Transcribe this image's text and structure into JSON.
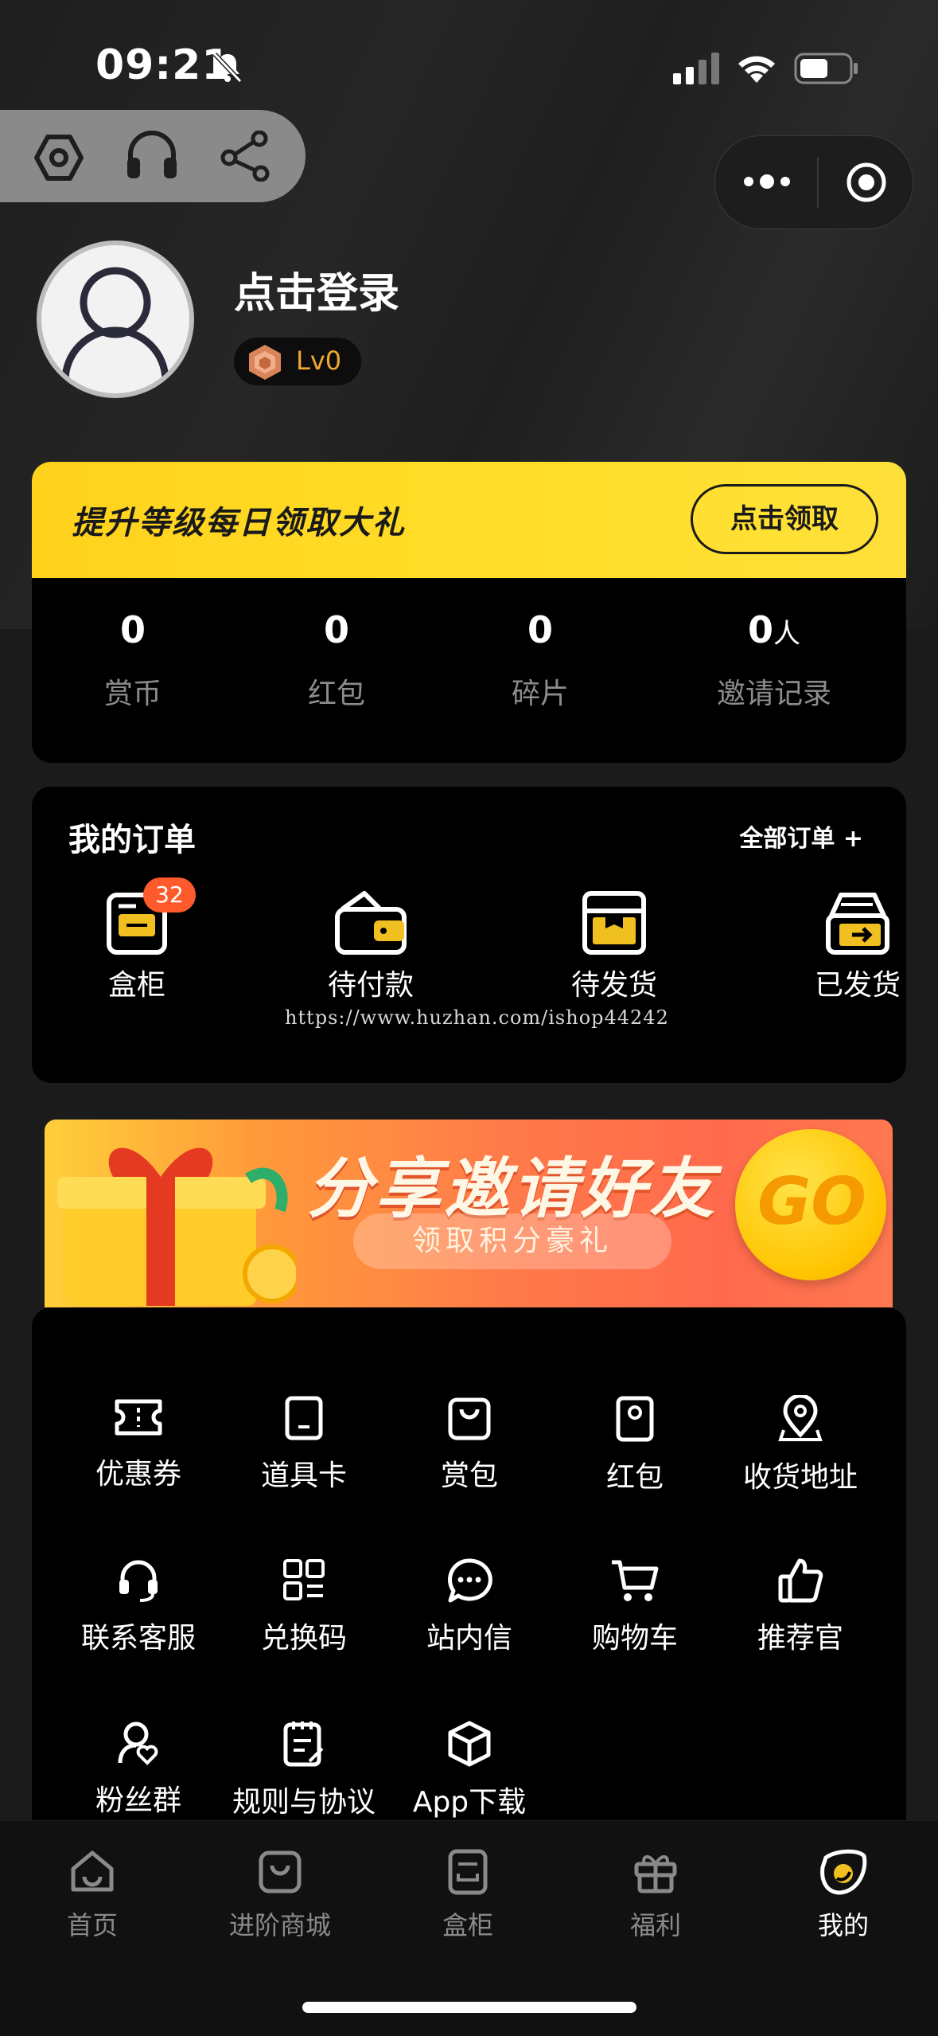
{
  "status_bar": {
    "time": "09:21"
  },
  "profile": {
    "login_text": "点击登录",
    "level": "Lv0"
  },
  "level_banner": {
    "title": "提升等级每日领取大礼",
    "button": "点击领取"
  },
  "stats": [
    {
      "value": "0",
      "unit": "",
      "label": "赏币"
    },
    {
      "value": "0",
      "unit": "",
      "label": "红包"
    },
    {
      "value": "0",
      "unit": "",
      "label": "碎片"
    },
    {
      "value": "0",
      "unit": "人",
      "label": "邀请记录"
    }
  ],
  "orders": {
    "title": "我的订单",
    "all_link": "全部订单 +",
    "items": [
      {
        "label": "盒柜",
        "badge": "32",
        "icon": "cabinet-icon"
      },
      {
        "label": "待付款",
        "icon": "wallet-icon"
      },
      {
        "label": "待发货",
        "icon": "box-icon"
      },
      {
        "label": "已发货",
        "icon": "shipped-icon"
      }
    ]
  },
  "watermark": "https://www.huzhan.com/ishop44242",
  "invite_banner": {
    "title": "分享邀请好友",
    "subtitle": "领取积分豪礼",
    "go": "GO"
  },
  "services": [
    {
      "label": "优惠券",
      "icon": "coupon-icon"
    },
    {
      "label": "道具卡",
      "icon": "card-icon"
    },
    {
      "label": "赏包",
      "icon": "bag-icon"
    },
    {
      "label": "红包",
      "icon": "red-packet-icon"
    },
    {
      "label": "收货地址",
      "icon": "location-icon"
    },
    {
      "label": "联系客服",
      "icon": "headset-icon"
    },
    {
      "label": "兑换码",
      "icon": "qrcode-icon"
    },
    {
      "label": "站内信",
      "icon": "message-icon"
    },
    {
      "label": "购物车",
      "icon": "cart-icon"
    },
    {
      "label": "推荐官",
      "icon": "thumbs-up-icon"
    },
    {
      "label": "粉丝群",
      "icon": "fans-icon"
    },
    {
      "label": "规则与协议",
      "icon": "rules-icon"
    },
    {
      "label": "App下载",
      "icon": "cube-icon"
    }
  ],
  "tabs": [
    {
      "label": "首页",
      "icon": "home-icon"
    },
    {
      "label": "进阶商城",
      "icon": "shop-icon"
    },
    {
      "label": "盒柜",
      "icon": "cabinet-icon"
    },
    {
      "label": "福利",
      "icon": "gift-icon"
    },
    {
      "label": "我的",
      "icon": "profile-icon",
      "active": true
    }
  ],
  "colors": {
    "accent_yellow": "#ffd21c",
    "badge_orange": "#ff5a2c",
    "level_gold": "#f0a830"
  }
}
